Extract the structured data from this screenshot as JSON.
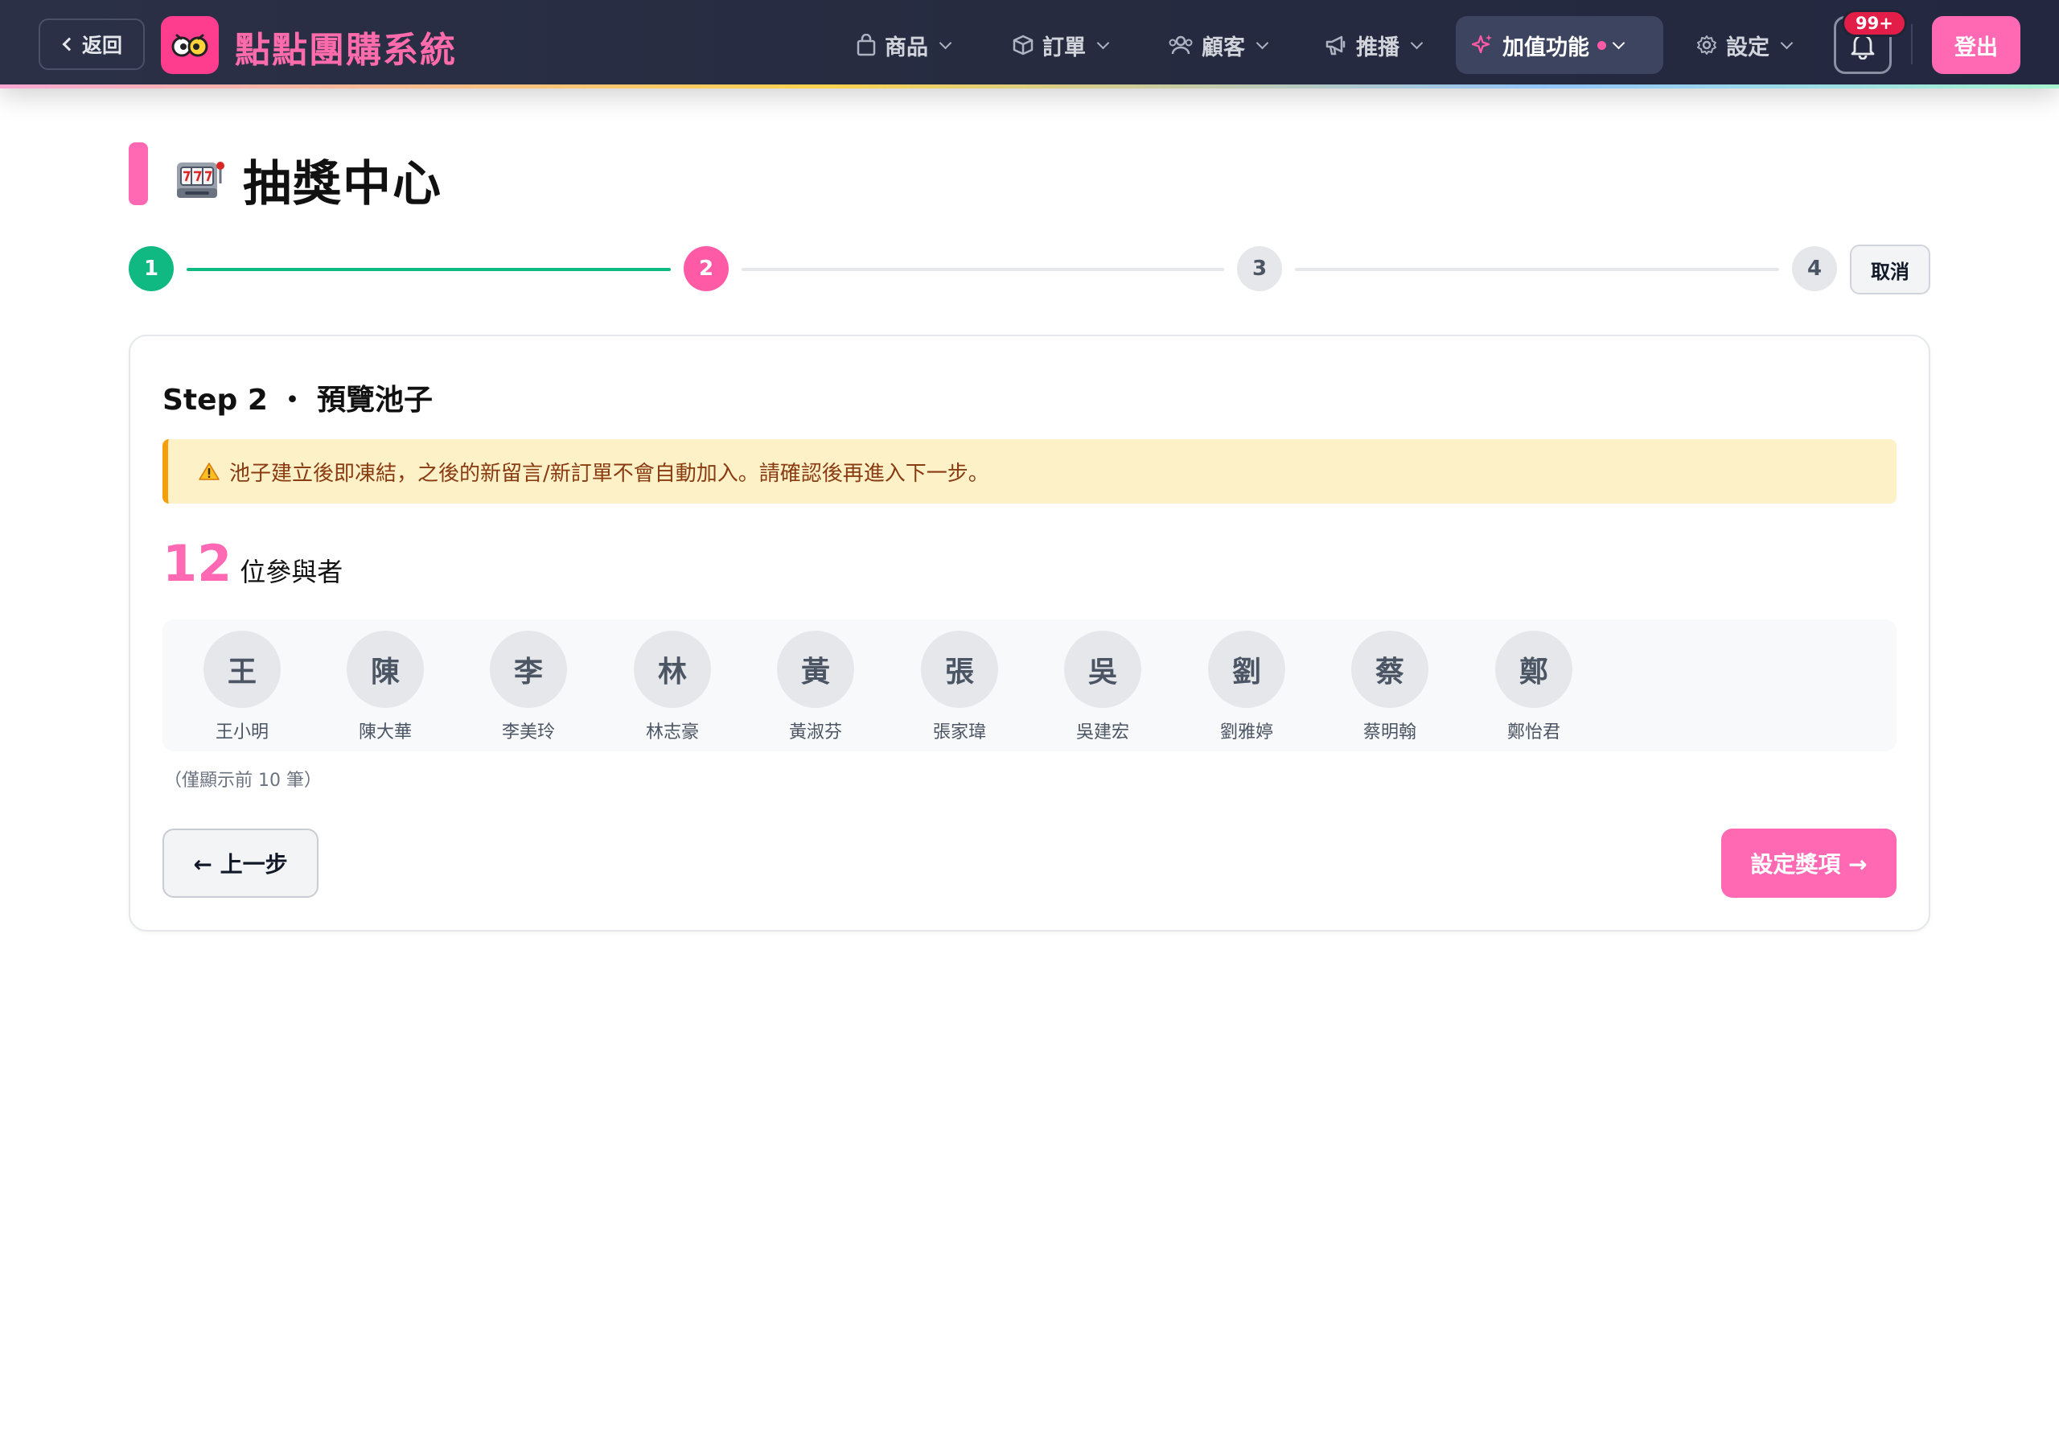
{
  "header": {
    "back_label": "返回",
    "brand": "點點團購系統",
    "nav": [
      {
        "label": "商品"
      },
      {
        "label": "訂單"
      },
      {
        "label": "顧客"
      },
      {
        "label": "推播"
      },
      {
        "label": "加值功能"
      },
      {
        "label": "設定"
      }
    ],
    "notification_badge": "99+",
    "logout_label": "登出"
  },
  "page": {
    "title": "抽獎中心"
  },
  "stepper": {
    "steps": [
      {
        "number": "1",
        "state": "done"
      },
      {
        "number": "2",
        "state": "current"
      },
      {
        "number": "3",
        "state": "todo"
      },
      {
        "number": "4",
        "state": "todo"
      }
    ],
    "cancel_label": "取消"
  },
  "card": {
    "title": "Step 2 ・ 預覽池子",
    "warning": "池子建立後即凍結，之後的新留言/新訂單不會自動加入。請確認後再進入下一步。",
    "participant_count": "12",
    "participant_label": "位參與者",
    "participants": [
      {
        "initial": "王",
        "name": "王小明"
      },
      {
        "initial": "陳",
        "name": "陳大華"
      },
      {
        "initial": "李",
        "name": "李美玲"
      },
      {
        "initial": "林",
        "name": "林志豪"
      },
      {
        "initial": "黃",
        "name": "黃淑芬"
      },
      {
        "initial": "張",
        "name": "張家瑋"
      },
      {
        "initial": "吳",
        "name": "吳建宏"
      },
      {
        "initial": "劉",
        "name": "劉雅婷"
      },
      {
        "initial": "蔡",
        "name": "蔡明翰"
      },
      {
        "initial": "鄭",
        "name": "鄭怡君"
      }
    ],
    "note": "（僅顯示前 10 筆）",
    "prev_label": "← 上一步",
    "next_label": "設定獎項 →"
  },
  "colors": {
    "accent": "#ff69b4",
    "done": "#10b981",
    "warning_border": "#f59e0b",
    "warning_bg": "#fdf1c7"
  }
}
